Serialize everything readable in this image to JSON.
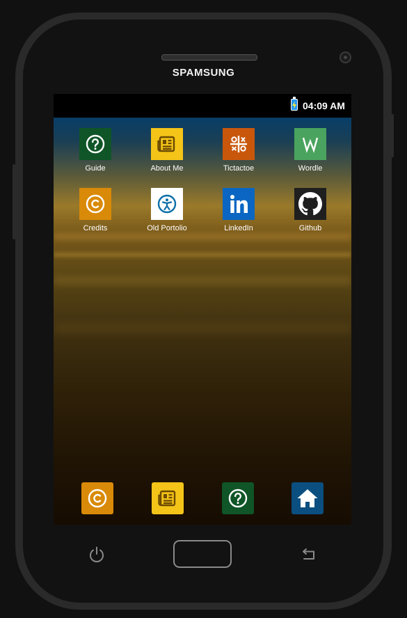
{
  "device": {
    "brand": "SPAMSUNG",
    "icons": {
      "camera": "camera-icon",
      "power": "power-icon",
      "back": "back-arrow-icon"
    }
  },
  "statusbar": {
    "time": "04:09 AM",
    "battery_icon": "battery-charging-icon",
    "battery_color": "#2196f3"
  },
  "apps": [
    {
      "label": "Guide",
      "icon": "question-circle-icon",
      "bg": "#0f5527"
    },
    {
      "label": "About Me",
      "icon": "newspaper-icon",
      "bg": "#f4c418"
    },
    {
      "label": "Tictactoe",
      "icon": "tictactoe-icon",
      "bg": "#c8570c"
    },
    {
      "label": "Wordle",
      "icon": "wordle-w-icon",
      "bg": "#4aa35e"
    },
    {
      "label": "Credits",
      "icon": "copyright-icon",
      "bg": "#d98a08"
    },
    {
      "label": "Old Portolio",
      "icon": "accessibility-icon",
      "bg": "#ffffff"
    },
    {
      "label": "LinkedIn",
      "icon": "linkedin-icon",
      "bg": "#0a66c2"
    },
    {
      "label": "Github",
      "icon": "github-icon",
      "bg": "#1f1f1f"
    }
  ],
  "dock": [
    {
      "icon": "copyright-icon",
      "bg": "#d98a08"
    },
    {
      "icon": "newspaper-icon",
      "bg": "#f4c418"
    },
    {
      "icon": "question-circle-icon",
      "bg": "#0f5527"
    },
    {
      "icon": "home-icon",
      "bg": "#0b4f80"
    }
  ]
}
